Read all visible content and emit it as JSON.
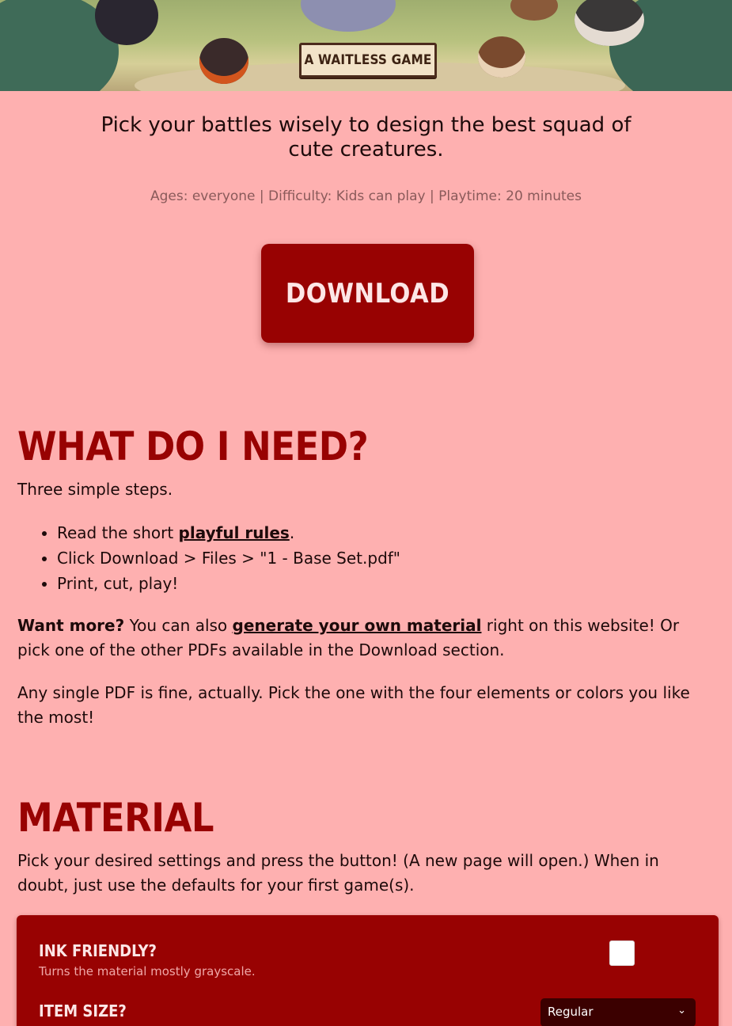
{
  "banner": {
    "logo_text": "A WAITLESS GAME"
  },
  "intro": {
    "tagline": "Pick your battles wisely to design the best squad of cute creatures.",
    "meta": "Ages: everyone | Difficulty: Kids can play | Playtime: 20 minutes",
    "download_label": "DOWNLOAD"
  },
  "need": {
    "heading": "WHAT DO I NEED?",
    "intro": "Three simple steps.",
    "step1_prefix": "Read the short ",
    "step1_link": "playful rules",
    "step1_suffix": ".",
    "step2": "Click Download > Files > \"1 - Base Set.pdf\"",
    "step3": "Print, cut, play!",
    "more_bold": "Want more?",
    "more_pre": " You can also ",
    "more_link": "generate your own material",
    "more_post": " right on this website! Or pick one of the other PDFs available in the Download section.",
    "single_pdf": "Any single PDF is fine, actually. Pick the one with the four elements or colors you like the most!"
  },
  "material": {
    "heading": "MATERIAL",
    "intro": "Pick your desired settings and press the button! (A new page will open.) When in doubt, just use the defaults for your first game(s).",
    "ink_title": "INK FRIENDLY?",
    "ink_desc": "Turns the material mostly grayscale.",
    "size_title": "ITEM SIZE?",
    "size_value": "Regular"
  },
  "icons": {
    "select_chevron": "chevron-down-icon"
  },
  "colors": {
    "background": "#feb0b0",
    "accent": "#980202",
    "select_bg": "#3b0000"
  }
}
